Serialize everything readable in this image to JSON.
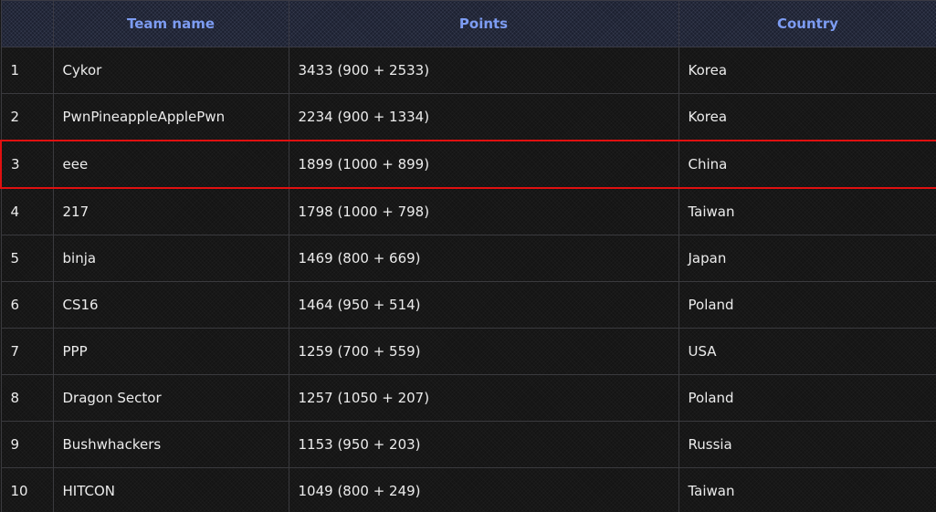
{
  "header": {
    "rank": "",
    "team": "Team name",
    "points": "Points",
    "country": "Country"
  },
  "highlight_color": "#e01010",
  "header_text_color": "#7d9cf2",
  "rows": [
    {
      "rank": "1",
      "team": "Cykor",
      "points": "3433 (900 + 2533)",
      "country": "Korea"
    },
    {
      "rank": "2",
      "team": "PwnPineappleApplePwn",
      "points": "2234 (900 + 1334)",
      "country": "Korea"
    },
    {
      "rank": "3",
      "team": "eee",
      "points": "1899 (1000 + 899)",
      "country": "China",
      "highlighted": true
    },
    {
      "rank": "4",
      "team": "217",
      "points": "1798 (1000 + 798)",
      "country": "Taiwan"
    },
    {
      "rank": "5",
      "team": "binja",
      "points": "1469 (800 + 669)",
      "country": "Japan"
    },
    {
      "rank": "6",
      "team": "CS16",
      "points": "1464 (950 + 514)",
      "country": "Poland"
    },
    {
      "rank": "7",
      "team": "PPP",
      "points": "1259 (700 + 559)",
      "country": "USA"
    },
    {
      "rank": "8",
      "team": "Dragon Sector",
      "points": "1257 (1050 + 207)",
      "country": "Poland"
    },
    {
      "rank": "9",
      "team": "Bushwhackers",
      "points": "1153 (950 + 203)",
      "country": "Russia"
    },
    {
      "rank": "10",
      "team": "HITCON",
      "points": "1049 (800 + 249)",
      "country": "Taiwan"
    }
  ]
}
